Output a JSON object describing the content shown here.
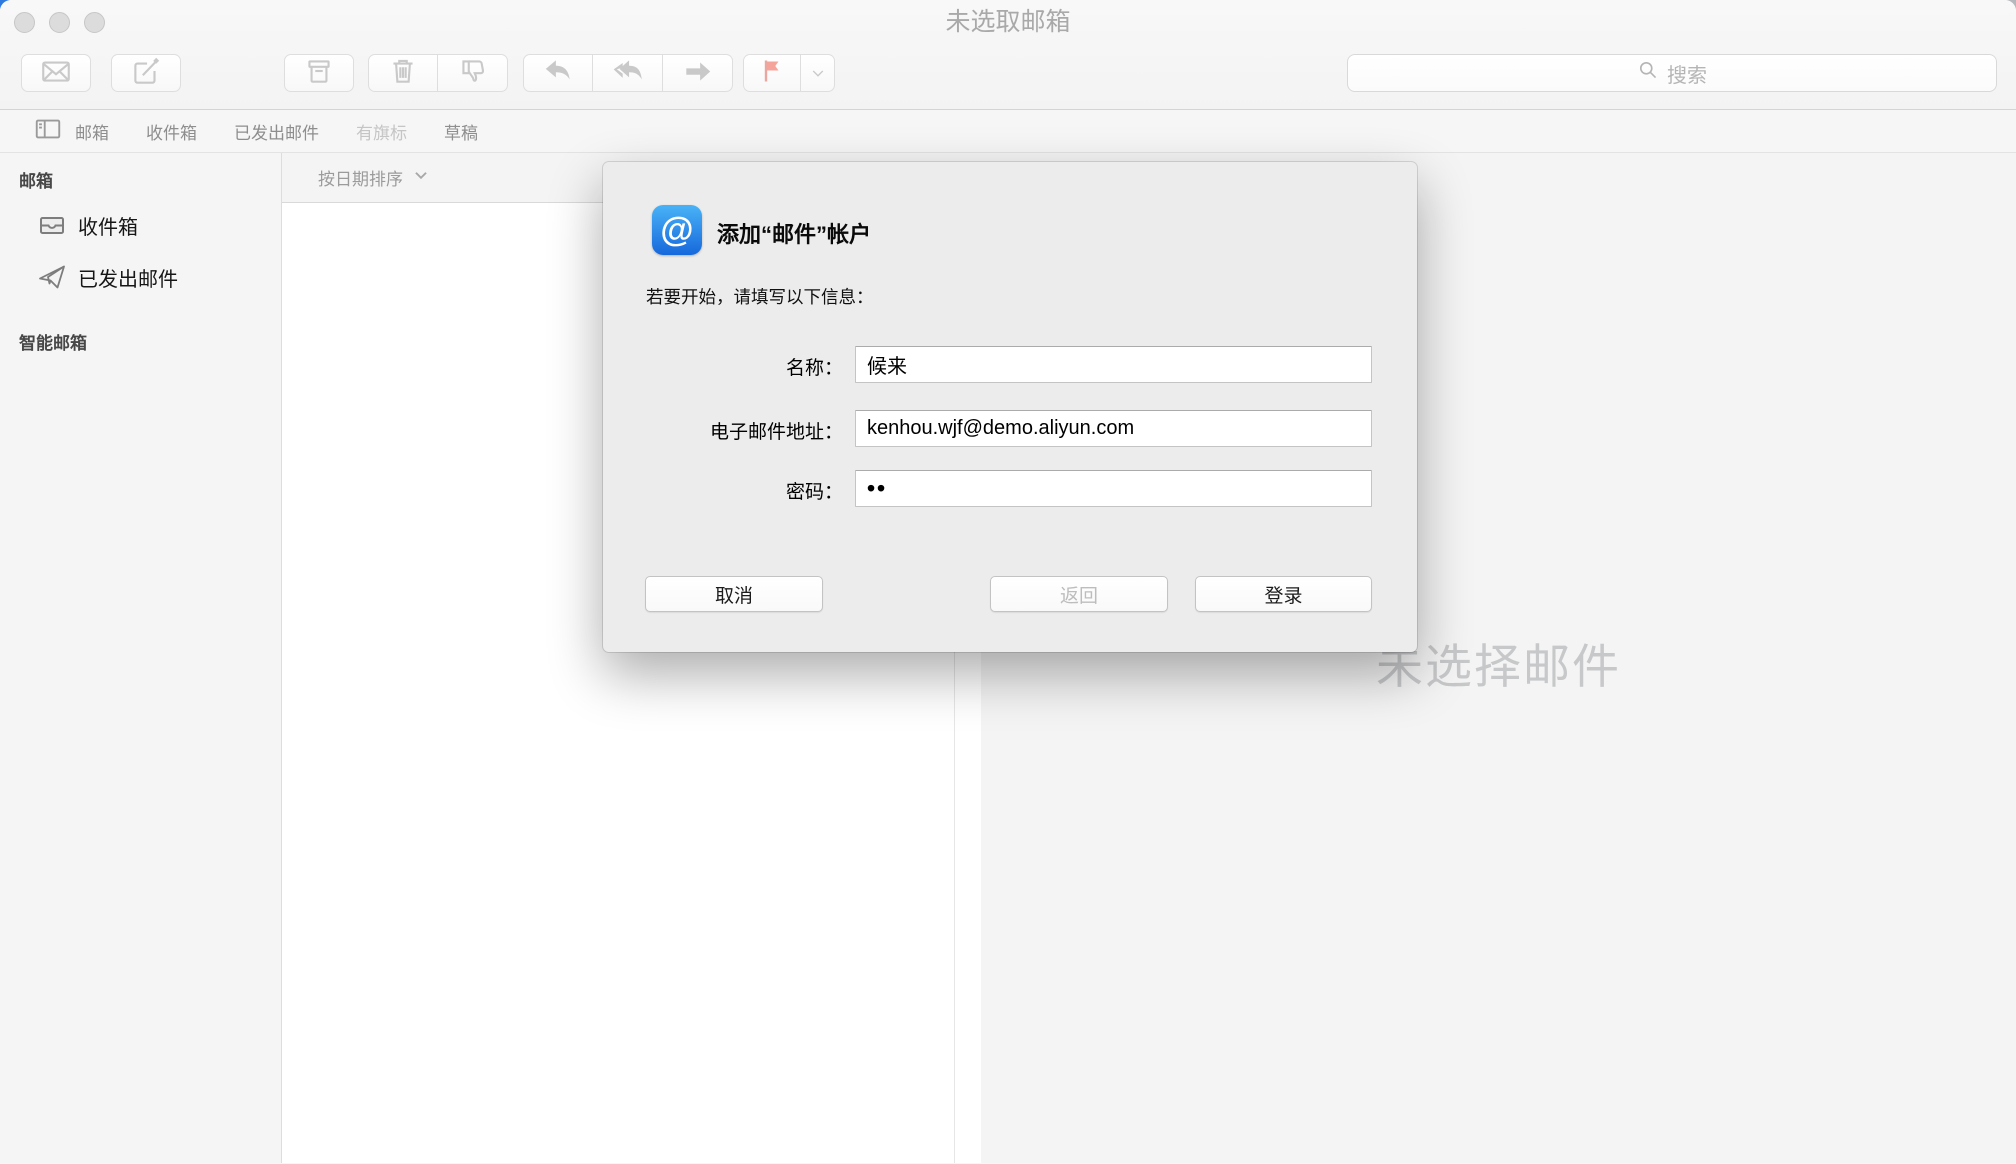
{
  "window": {
    "title": "未选取邮箱"
  },
  "toolbar": {
    "icons": [
      "get-mail-envelope-icon",
      "compose-icon",
      "archive-icon",
      "trash-icon",
      "junk-thumbs-down-icon",
      "reply-icon",
      "reply-all-icon",
      "forward-icon",
      "flag-icon",
      "flag-chevron-down-icon"
    ],
    "search_placeholder": "搜索",
    "flag_color": "#f5a49c"
  },
  "favorites_bar": {
    "items": [
      {
        "label": "邮箱",
        "enabled": true
      },
      {
        "label": "收件箱",
        "enabled": true
      },
      {
        "label": "已发出邮件",
        "enabled": true
      },
      {
        "label": "有旗标",
        "enabled": false
      },
      {
        "label": "草稿",
        "enabled": true
      }
    ]
  },
  "sidebar": {
    "mailboxes_header": "邮箱",
    "items": [
      {
        "label": "收件箱",
        "icon": "inbox-tray-icon"
      },
      {
        "label": "已发出邮件",
        "icon": "paper-plane-icon"
      }
    ],
    "smart_header": "智能邮箱"
  },
  "message_list": {
    "sort_label": "按日期排序"
  },
  "message_view": {
    "empty_state": "未选择邮件"
  },
  "dialog": {
    "icon_glyph": "@",
    "icon_colors": {
      "top": "#49b3f6",
      "bottom": "#1668dc"
    },
    "title": "添加“邮件”帐户",
    "subtitle": "若要开始，请填写以下信息：",
    "fields": {
      "name_label": "名称：",
      "name_value": "候来",
      "email_label": "电子邮件地址：",
      "email_value": "kenhou.wjf@demo.aliyun.com",
      "password_label": "密码：",
      "password_value": "••"
    },
    "buttons": {
      "cancel": "取消",
      "back": "返回",
      "login": "登录"
    }
  }
}
